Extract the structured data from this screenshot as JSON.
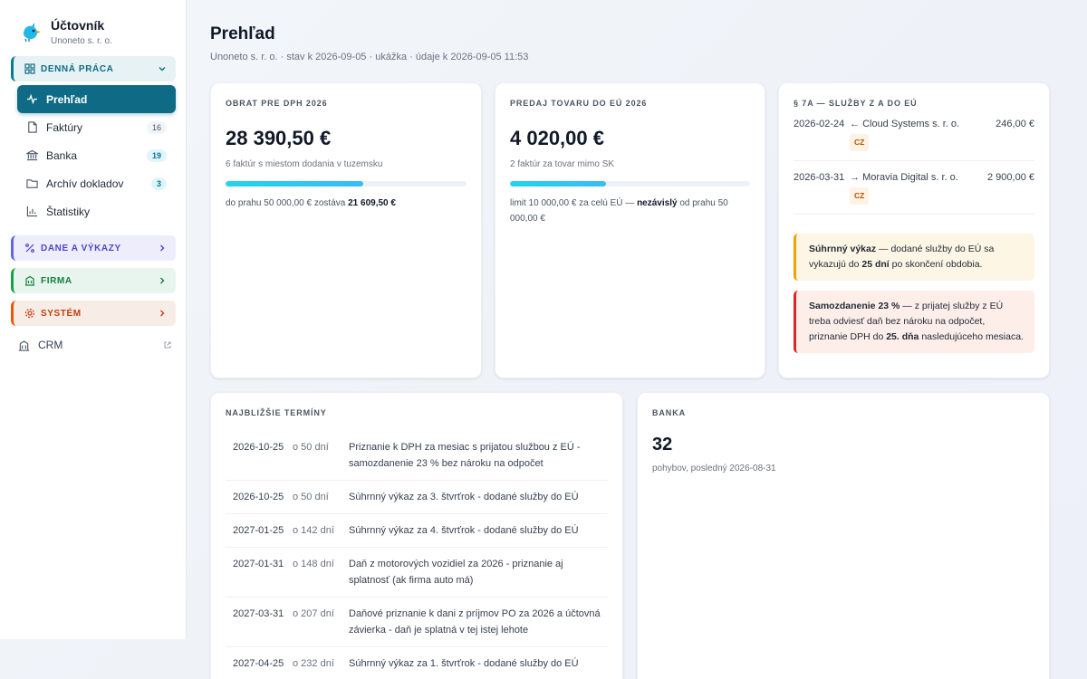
{
  "brand": {
    "title": "Účtovník",
    "subtitle": "Unoneto s. r. o."
  },
  "sidebar": {
    "groups": {
      "denna": "Denná práca",
      "dane": "Dane a výkazy",
      "firma": "Firma",
      "system": "Systém"
    },
    "items": [
      {
        "label": "Prehľad",
        "badge": ""
      },
      {
        "label": "Faktúry",
        "badge": "16"
      },
      {
        "label": "Banka",
        "badge": "19"
      },
      {
        "label": "Archív dokladov",
        "badge": "3"
      },
      {
        "label": "Štatistiky",
        "badge": ""
      }
    ],
    "crm": "CRM"
  },
  "header": {
    "title": "Prehľad",
    "subtitle": "Unoneto s. r. o. · stav k 2026-09-05 · ukážka · údaje k 2026-09-05 11:53"
  },
  "cards": {
    "dph": {
      "heading": "Obrat pre DPH 2026",
      "value": "28 390,50 €",
      "desc": "6 faktúr s miestom dodania v tuzemsku",
      "progress": 0.57,
      "note_pre": "do prahu 50 000,00 € zostáva ",
      "note_bold": "21 609,50 €"
    },
    "eu": {
      "heading": "Predaj tovaru do EÚ 2026",
      "value": "4 020,00 €",
      "desc": "2 faktúr za tovar mimo SK",
      "progress": 0.4,
      "note_pre": "limit 10 000,00 € za celú EÚ — ",
      "note_bold": "nezávislý",
      "note_post": " od prahu 50 000,00 €"
    },
    "services": {
      "heading": "§ 7a — služby z a do EÚ",
      "rows": [
        {
          "date": "2026-02-24",
          "dir": "←",
          "name": "Cloud Systems s. r. o.",
          "country": "CZ",
          "amount": "246,00 €"
        },
        {
          "date": "2026-03-31",
          "dir": "→",
          "name": "Moravia Digital s. r. o.",
          "country": "CZ",
          "amount": "2 900,00 €"
        }
      ],
      "alert_yellow": {
        "bold": "Súhrnný výkaz",
        "text1": " — dodané služby do EÚ sa vykazujú do ",
        "bold2": "25 dní",
        "text2": " po skončení obdobia."
      },
      "alert_red": {
        "bold": "Samozdanenie 23 %",
        "text1": " — z prijatej služby z EÚ treba odviesť daň bez nároku na odpočet, priznanie DPH do ",
        "bold2": "25. dňa",
        "text2": " nasledujúceho mesiaca."
      }
    },
    "terms": {
      "heading": "Najbližšie termíny",
      "rows": [
        {
          "date": "2026-10-25",
          "in": "o 50 dní",
          "text": "Priznanie k DPH za mesiac s prijatou službou z EÚ - samozdanenie 23 % bez nároku na odpočet"
        },
        {
          "date": "2026-10-25",
          "in": "o 50 dní",
          "text": "Súhrnný výkaz za 3. štvrťrok - dodané služby do EÚ"
        },
        {
          "date": "2027-01-25",
          "in": "o 142 dní",
          "text": "Súhrnný výkaz za 4. štvrťrok - dodané služby do EÚ"
        },
        {
          "date": "2027-01-31",
          "in": "o 148 dní",
          "text": "Daň z motorových vozidiel za 2026 - priznanie aj splatnosť (ak firma auto má)"
        },
        {
          "date": "2027-03-31",
          "in": "o 207 dní",
          "text": "Daňové priznanie k dani z príjmov PO za 2026 a účtovná závierka - daň je splatná v tej istej lehote"
        },
        {
          "date": "2027-04-25",
          "in": "o 232 dní",
          "text": "Súhrnný výkaz za 1. štvrťrok - dodané služby do EÚ"
        }
      ]
    },
    "bank": {
      "heading": "Banka",
      "value": "32",
      "desc": "pohybov, posledný 2026-08-31"
    }
  }
}
